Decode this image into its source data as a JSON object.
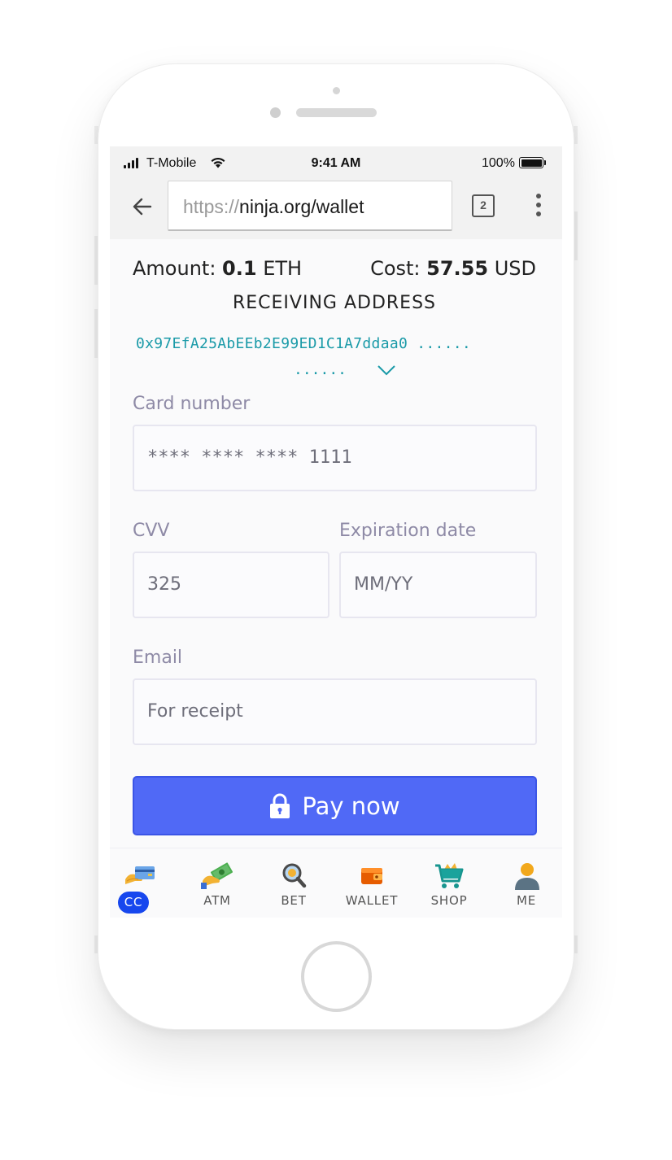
{
  "status_bar": {
    "carrier": "T-Mobile",
    "time": "9:41 AM",
    "battery": "100%"
  },
  "browser": {
    "url_scheme": "https://",
    "url_host": "ninja.org/wallet",
    "tab_count": "2"
  },
  "order": {
    "amount_label": "Amount:",
    "amount_value": "0.1",
    "amount_unit": "ETH",
    "cost_label": "Cost:",
    "cost_value": "57.55",
    "cost_unit": "USD"
  },
  "receiving": {
    "title": "RECEIVING ADDRESS",
    "address": "0x97EfA25AbEEb2E99ED1C1A7ddaa0",
    "dots_1": "......",
    "dots_2": "......"
  },
  "form": {
    "card_label": "Card number",
    "card_value": "**** **** **** 1111",
    "cvv_label": "CVV",
    "cvv_value": "325",
    "expiry_label": "Expiration date",
    "expiry_placeholder": "MM/YY",
    "email_label": "Email",
    "email_placeholder": "For receipt",
    "pay_label": "Pay now"
  },
  "nav": {
    "items": [
      {
        "label": "CC",
        "icon": "credit-card-hand-icon",
        "active": true
      },
      {
        "label": "ATM",
        "icon": "cash-hand-icon",
        "active": false
      },
      {
        "label": "BET",
        "icon": "magnifier-icon",
        "active": false
      },
      {
        "label": "WALLET",
        "icon": "wallet-icon",
        "active": false
      },
      {
        "label": "SHOP",
        "icon": "shopping-cart-icon",
        "active": false
      },
      {
        "label": "ME",
        "icon": "person-icon",
        "active": false
      }
    ]
  },
  "colors": {
    "accent": "#5069f6",
    "active_tab": "#1747ee",
    "address": "#1a9aa8"
  }
}
